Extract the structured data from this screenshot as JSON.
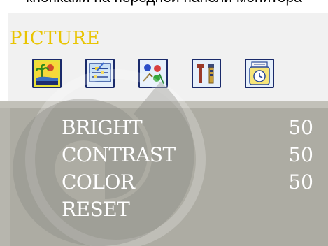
{
  "caption": {
    "text": "кнопками на передней панели мониторa"
  },
  "menu": {
    "title": "PICTURE",
    "icons": [
      {
        "name": "picture-icon",
        "selected": true
      },
      {
        "name": "display-settings-icon",
        "selected": false
      },
      {
        "name": "color-icon",
        "selected": false
      },
      {
        "name": "tools-icon",
        "selected": false
      },
      {
        "name": "clock-icon",
        "selected": false
      }
    ]
  },
  "settings": [
    {
      "label": "BRIGHT",
      "value": "50"
    },
    {
      "label": "CONTRAST",
      "value": "50"
    },
    {
      "label": "COLOR",
      "value": "50"
    },
    {
      "label": "RESET",
      "value": ""
    }
  ],
  "colors": {
    "title": "#e9c400",
    "panel": "#adaca3",
    "header_bg": "#f1f1f1",
    "text": "#ffffff",
    "icon_border": "#1a2a6a"
  }
}
